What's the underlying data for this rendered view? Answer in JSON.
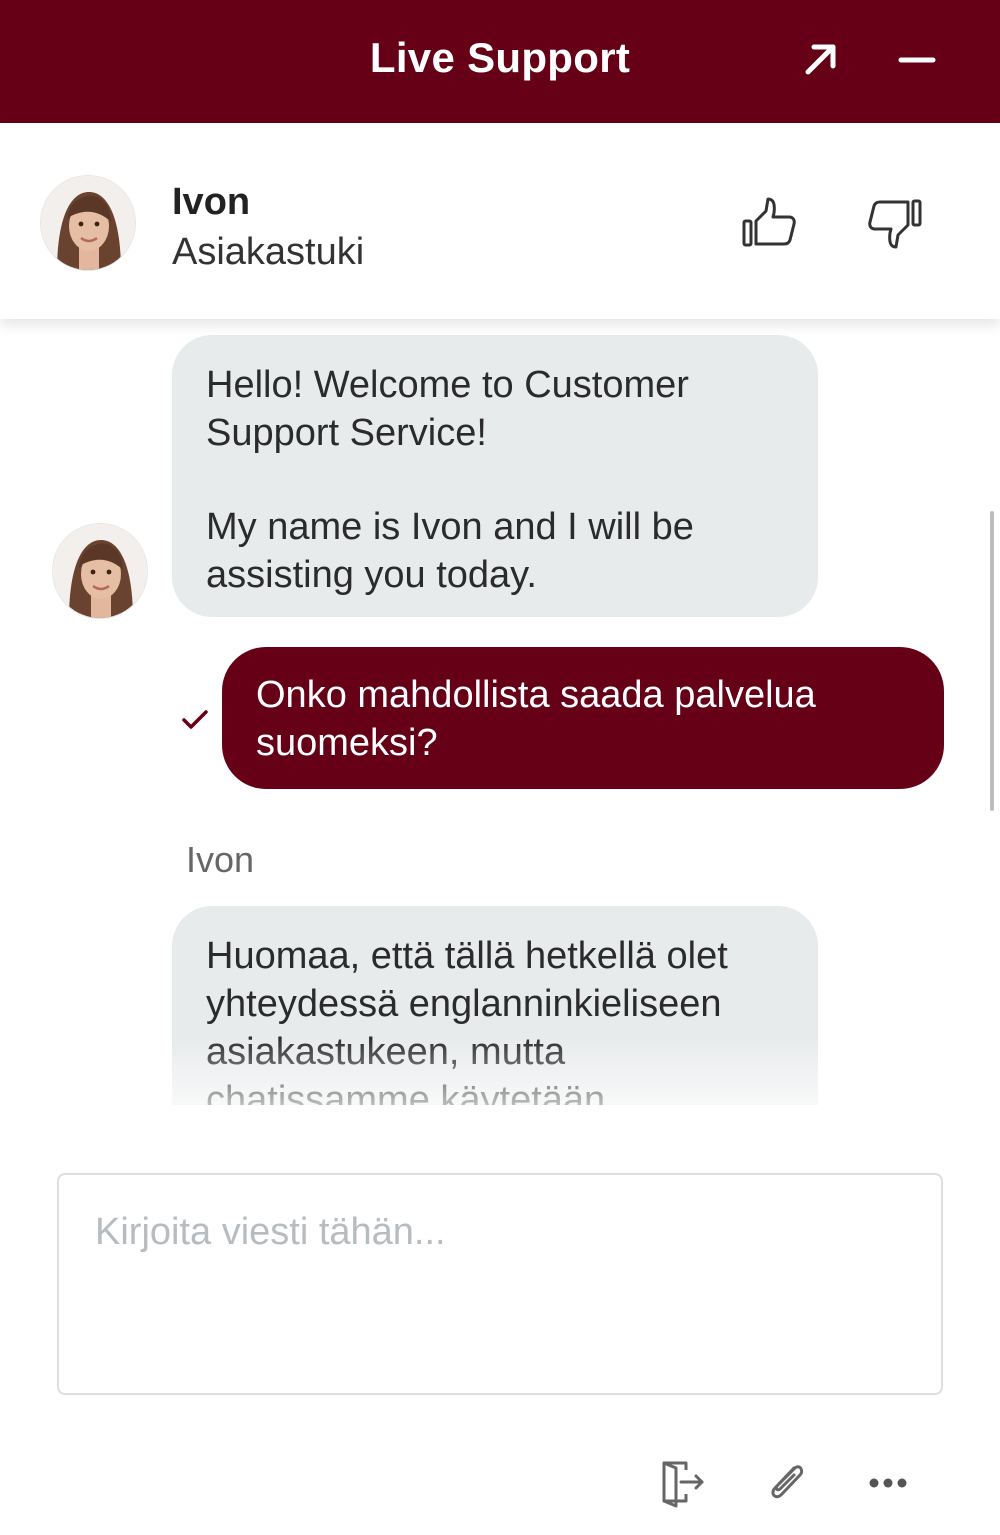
{
  "header": {
    "title": "Live Support",
    "popout_icon": "arrow-up-right-icon",
    "minimize_icon": "minus-icon"
  },
  "agent": {
    "name": "Ivon",
    "department": "Asiakastuki"
  },
  "messages": [
    {
      "from": "agent",
      "paragraphs": [
        "Hello! Welcome to Customer Support Service!",
        "My name is Ivon and I will be assisting you today."
      ]
    },
    {
      "from": "user",
      "text": "Onko mahdollista saada palvelua suomeksi?",
      "status_icon": "checkmark-icon"
    },
    {
      "from": "agent",
      "sender": "Ivon",
      "text": "Huomaa, että tällä hetkellä olet yhteydessä englanninkieliseen asiakastukeen, mutta chatissamme käytetään"
    }
  ],
  "composer": {
    "placeholder": "Kirjoita viesti tähän..."
  },
  "colors": {
    "brand": "#650016",
    "agent_bubble": "#e8ebec"
  }
}
